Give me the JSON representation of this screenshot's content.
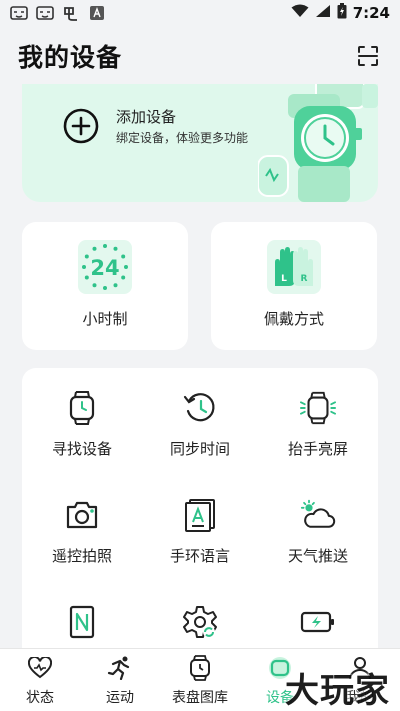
{
  "status_bar": {
    "time": "7:24",
    "left_icons": [
      "face-mask-icon",
      "face-mask-icon",
      "app-icon",
      "a-box-icon"
    ],
    "right_icons": [
      "wifi-icon",
      "signal-icon",
      "battery-icon"
    ]
  },
  "header": {
    "title": "我的设备",
    "scan_icon": "scan-icon"
  },
  "add_device": {
    "title": "添加设备",
    "subtitle": "绑定设备，体验更多功能"
  },
  "quick_cards": [
    {
      "label": "小时制",
      "icon_text": "24",
      "icon": "clock-24-icon"
    },
    {
      "label": "佩戴方式",
      "icon": "hands-lr-icon",
      "left_letter": "L",
      "right_letter": "R"
    }
  ],
  "grid_items": [
    {
      "label": "寻找设备",
      "icon": "watch-find-icon"
    },
    {
      "label": "同步时间",
      "icon": "sync-clock-icon"
    },
    {
      "label": "抬手亮屏",
      "icon": "watch-glow-icon"
    },
    {
      "label": "遥控拍照",
      "icon": "camera-icon"
    },
    {
      "label": "手环语言",
      "icon": "language-a-icon"
    },
    {
      "label": "天气推送",
      "icon": "weather-icon"
    },
    {
      "label": "",
      "icon": "nfc-icon"
    },
    {
      "label": "",
      "icon": "gear-sync-icon"
    },
    {
      "label": "",
      "icon": "battery-charge-icon"
    }
  ],
  "bottom_nav": [
    {
      "label": "状态",
      "icon": "heart-icon",
      "active": false
    },
    {
      "label": "运动",
      "icon": "runner-icon",
      "active": false
    },
    {
      "label": "表盘图库",
      "icon": "watchface-icon",
      "active": false
    },
    {
      "label": "设备",
      "icon": "device-icon",
      "active": true
    },
    {
      "label": "我的",
      "icon": "person-icon",
      "active": false
    }
  ],
  "watermark": "大玩家",
  "colors": {
    "accent": "#2fc28a",
    "card_green": "#dff8ec",
    "background": "#f2f3f5"
  }
}
